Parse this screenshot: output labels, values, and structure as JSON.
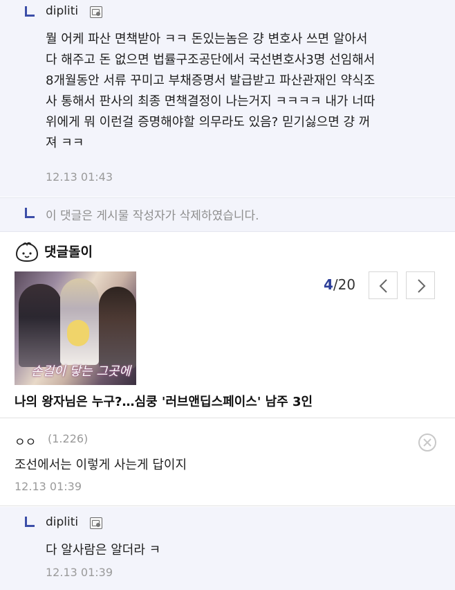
{
  "reply1": {
    "author": "dipliti",
    "lines": [
      "뭘 어케 파산 면책받아 ㅋㅋ 돈있는놈은 걍 변호사 쓰면 알아서",
      "다 해주고 돈 없으면 법률구조공단에서 국선변호사3명 선임해서",
      "8개월동안 서류 꾸미고 부채증명서 발급받고 파산관재인 약식조",
      "사 통해서 판사의 최종 면책결정이 나는거지 ㅋㅋㅋㅋ 내가 너따",
      "위에게 뭐 이런걸 증명해야할 의무라도 있음? 믿기싫으면 걍 꺼",
      "져 ㅋㅋ"
    ],
    "time": "12.13 01:43"
  },
  "deleted": {
    "text": "이 댓글은 게시물 작성자가 삭제하였습니다."
  },
  "bot": {
    "title": "댓글돌이",
    "thumb_caption": "손길이 닿는 그곳에",
    "page_current": "4",
    "page_total": "/20",
    "headline": "나의 왕자님은 누구?…심쿵 '러브앤딥스페이스' 남주 3인"
  },
  "comment": {
    "user": "ㅇㅇ",
    "ip": "(1.226)",
    "text": "조선에서는 이렇게 사는게 답이지",
    "time": "12.13 01:39"
  },
  "reply2": {
    "author": "dipliti",
    "text": "다 알사람은 알더라 ㅋ",
    "time": "12.13 01:39"
  },
  "colors": {
    "reply_bg": "#f3f4fb",
    "accent": "#3c4ea8",
    "pager_accent": "#2d3f99"
  },
  "icons": [
    "reply-arrow-icon",
    "author-badge-icon",
    "bot-mascot-icon",
    "chevron-left-icon",
    "chevron-right-icon",
    "delete-circle-icon"
  ]
}
